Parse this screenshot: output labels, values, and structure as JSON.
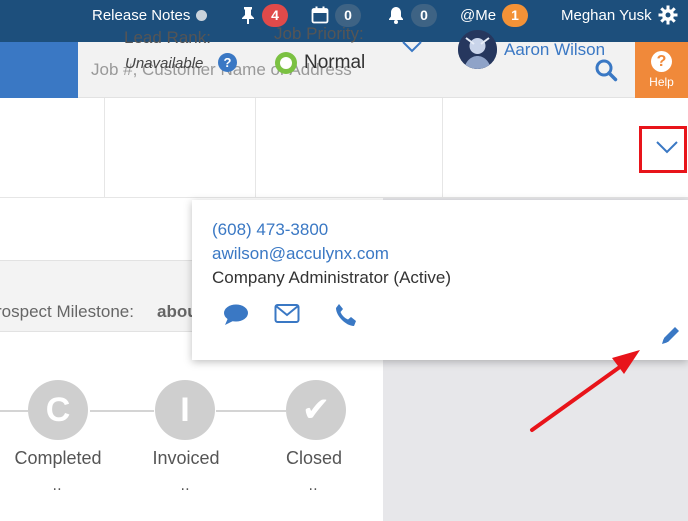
{
  "topbar": {
    "release_notes": "Release Notes",
    "pin_count": "4",
    "calendar_count": "0",
    "bell_count": "0",
    "mention_label": "@Me",
    "mention_count": "1",
    "user_name": "Meghan Yusk"
  },
  "search": {
    "placeholder": "Job #, Customer Name or Address"
  },
  "help": {
    "label": "Help",
    "glyph": "?"
  },
  "job_info": {
    "lead_rank_label": "Lead Rank:",
    "lead_rank_value": "Unavailable",
    "info_glyph": "?",
    "job_priority_label": "Job Priority:",
    "job_priority_value": "Normal",
    "assigned_user": "Aaron Wilson"
  },
  "popover": {
    "phone": "(608) 473-3800",
    "email": "awilson@acculynx.com",
    "role": "Company Administrator (Active)"
  },
  "prospect": {
    "label": "rospect Milestone:",
    "value": "abou"
  },
  "milestones": [
    {
      "letter": "C",
      "label": "Completed"
    },
    {
      "letter": "I",
      "label": "Invoiced"
    },
    {
      "letter": "✔",
      "label": "Closed"
    }
  ],
  "colors": {
    "topbar": "#1d4f7c",
    "accent_blue": "#3a78c4",
    "help_orange": "#f0893a",
    "priority_green": "#7bc142",
    "annotation_red": "#e8141a"
  }
}
